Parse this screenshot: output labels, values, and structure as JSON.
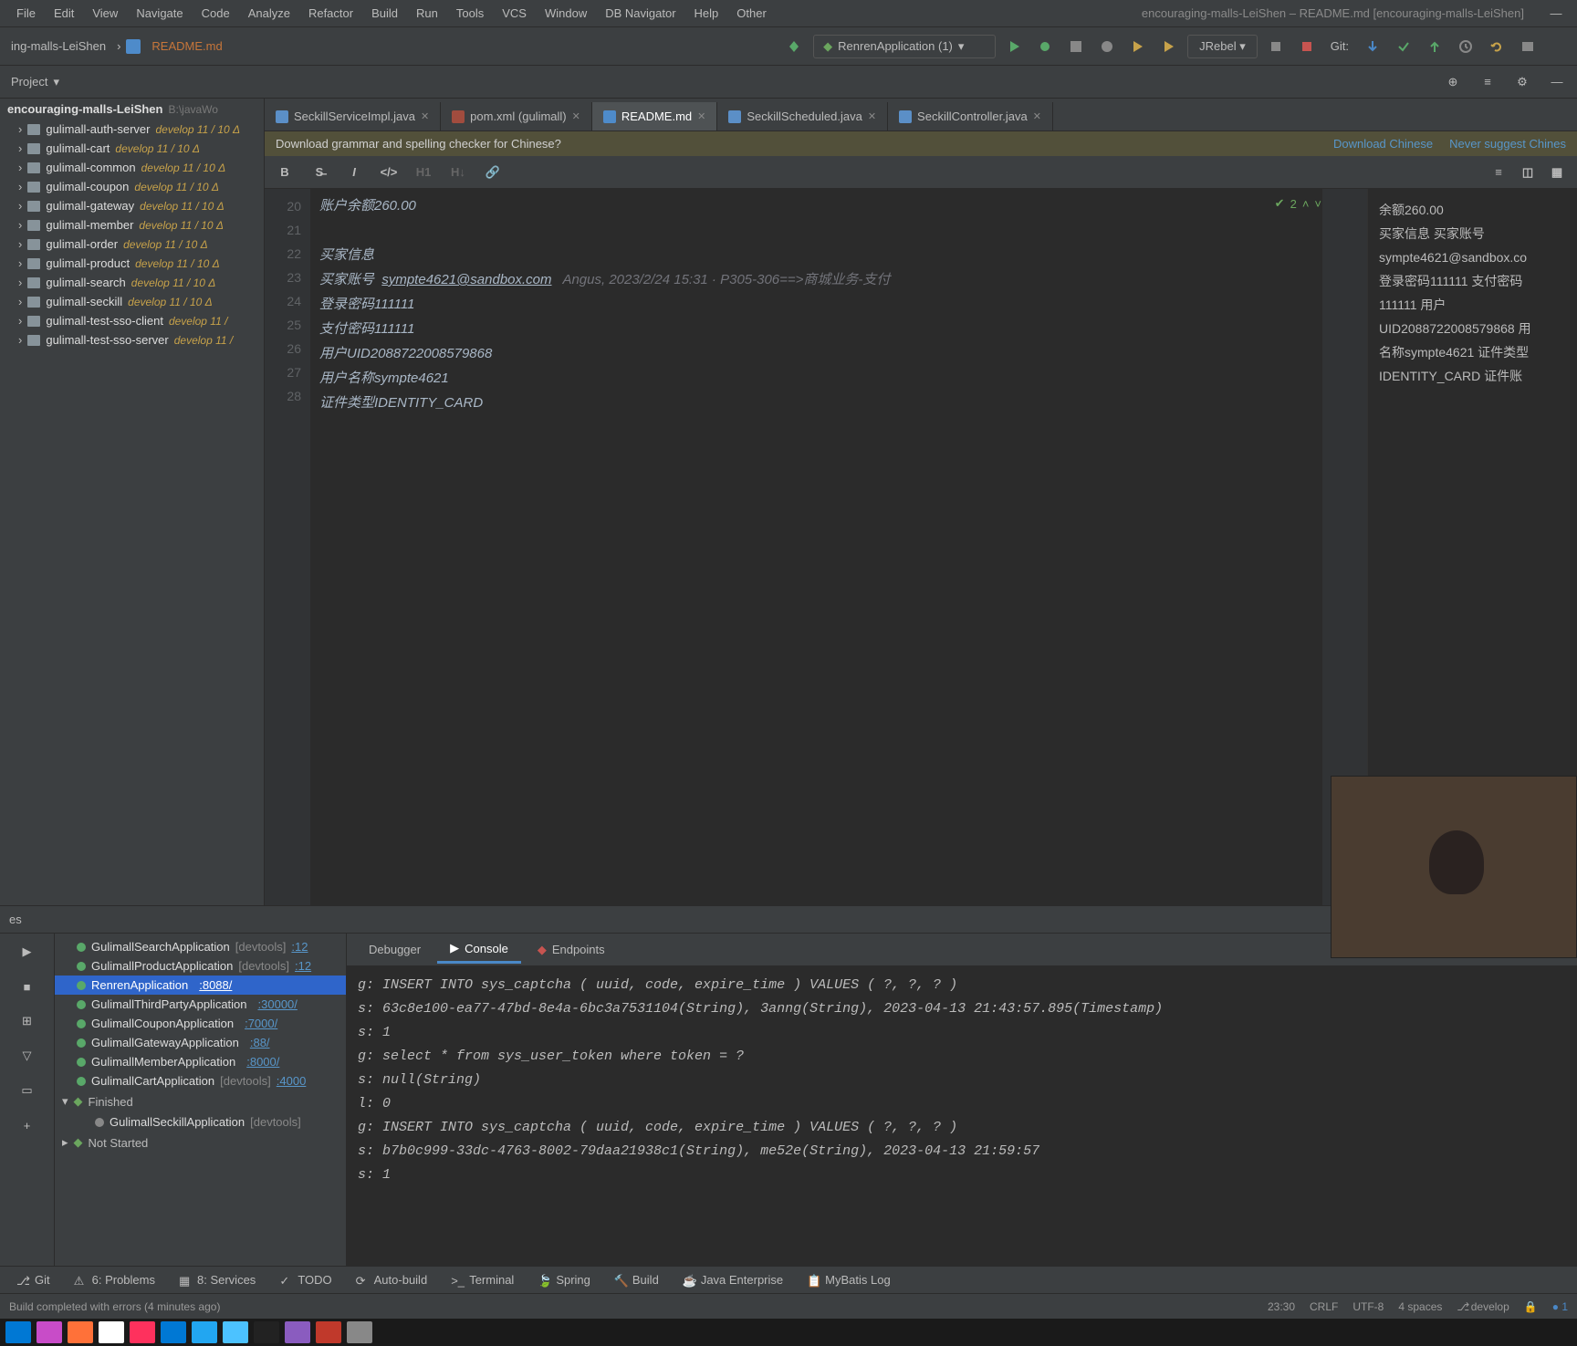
{
  "window_title": "encouraging-malls-LeiShen – README.md [encouraging-malls-LeiShen]",
  "menus": [
    "File",
    "Edit",
    "View",
    "Navigate",
    "Code",
    "Analyze",
    "Refactor",
    "Build",
    "Run",
    "Tools",
    "VCS",
    "Window",
    "DB Navigator",
    "Help",
    "Other"
  ],
  "breadcrumb": {
    "project": "ing-malls-LeiShen",
    "file": "README.md"
  },
  "run_config": "RenrenApplication (1)",
  "jrebel": "JRebel",
  "git_label": "Git:",
  "project_label": "Project",
  "tree_root": {
    "name": "encouraging-malls-LeiShen",
    "path": "B:\\javaWo"
  },
  "tree": [
    {
      "name": "gulimall-auth-server",
      "branch": "develop 11 / 10 Δ"
    },
    {
      "name": "gulimall-cart",
      "branch": "develop 11 / 10 Δ"
    },
    {
      "name": "gulimall-common",
      "branch": "develop 11 / 10 Δ"
    },
    {
      "name": "gulimall-coupon",
      "branch": "develop 11 / 10 Δ"
    },
    {
      "name": "gulimall-gateway",
      "branch": "develop 11 / 10 Δ"
    },
    {
      "name": "gulimall-member",
      "branch": "develop 11 / 10 Δ"
    },
    {
      "name": "gulimall-order",
      "branch": "develop 11 / 10 Δ"
    },
    {
      "name": "gulimall-product",
      "branch": "develop 11 / 10 Δ"
    },
    {
      "name": "gulimall-search",
      "branch": "develop 11 / 10 Δ"
    },
    {
      "name": "gulimall-seckill",
      "branch": "develop 11 / 10 Δ"
    },
    {
      "name": "gulimall-test-sso-client",
      "branch": "develop 11 /"
    },
    {
      "name": "gulimall-test-sso-server",
      "branch": "develop 11 /"
    }
  ],
  "tabs": [
    {
      "label": "SeckillServiceImpl.java",
      "type": "java"
    },
    {
      "label": "pom.xml (gulimall)",
      "type": "xml"
    },
    {
      "label": "README.md",
      "type": "md",
      "active": true
    },
    {
      "label": "SeckillScheduled.java",
      "type": "java"
    },
    {
      "label": "SeckillController.java",
      "type": "java"
    }
  ],
  "banner": {
    "msg": "Download grammar and spelling checker for Chinese?",
    "link1": "Download Chinese",
    "link2": "Never suggest Chines"
  },
  "inspection": {
    "count": "2"
  },
  "gutter": [
    "20",
    "21",
    "22",
    "23",
    "24",
    "25",
    "26",
    "27",
    "28"
  ],
  "code": {
    "l20": "账户余额260.00",
    "l21": "",
    "l22": "买家信息",
    "l23a": "买家账号  ",
    "l23b": "sympte4621@sandbox.com",
    "l23c": "   Angus, 2023/2/24 15:31 · P305-306==>商城业务-支付",
    "l24": "登录密码111111",
    "l25": "支付密码111111",
    "l26": "用户UID2088722008579868",
    "l27": "用户名称sympte4621",
    "l28": "证件类型IDENTITY_CARD"
  },
  "preview": [
    "余额260.00",
    "",
    "买家信息 买家账号",
    "sympte4621@sandbox.co",
    "登录密码111111 支付密码",
    "111111 用户",
    "UID2088722008579868 用",
    "名称sympte4621 证件类型",
    "IDENTITY_CARD 证件账"
  ],
  "svc_header": "",
  "svc_apps": [
    {
      "name": "GulimallSearchApplication",
      "meta": "[devtools]",
      "port": ":12"
    },
    {
      "name": "GulimallProductApplication",
      "meta": "[devtools]",
      "port": ":12"
    },
    {
      "name": "RenrenApplication",
      "meta": "",
      "port": ":8088/",
      "selected": true
    },
    {
      "name": "GulimallThirdPartyApplication",
      "meta": "",
      "port": ":30000/"
    },
    {
      "name": "GulimallCouponApplication",
      "meta": "",
      "port": ":7000/"
    },
    {
      "name": "GulimallGatewayApplication",
      "meta": "",
      "port": ":88/"
    },
    {
      "name": "GulimallMemberApplication",
      "meta": "",
      "port": ":8000/"
    },
    {
      "name": "GulimallCartApplication",
      "meta": "[devtools]",
      "port": ":4000"
    }
  ],
  "svc_groups": [
    {
      "label": "Finished",
      "open": true,
      "children": [
        {
          "name": "GulimallSeckillApplication",
          "meta": "[devtools]"
        }
      ]
    },
    {
      "label": "Not Started",
      "open": false
    }
  ],
  "svc_tabs": {
    "debugger": "Debugger",
    "console": "Console",
    "endpoints": "Endpoints"
  },
  "console_lines": [
    "g: INSERT INTO sys_captcha ( uuid, code, expire_time ) VALUES ( ?, ?, ? )",
    "s: 63c8e100-ea77-47bd-8e4a-6bc3a7531104(String), 3anng(String), 2023-04-13 21:43:57.895(Timestamp)",
    "s: 1",
    "g: select * from sys_user_token where token = ?",
    "s: null(String)",
    "l: 0",
    "g: INSERT INTO sys_captcha ( uuid, code, expire_time ) VALUES ( ?, ?, ? )",
    "s: b7b0c999-33dc-4763-8002-79daa21938c1(String), me52e(String), 2023-04-13 21:59:57",
    "s: 1"
  ],
  "tooltabs": [
    "Git",
    "6: Problems",
    "8: Services",
    "TODO",
    "Auto-build",
    "Terminal",
    "Spring",
    "Build",
    "Java Enterprise",
    "MyBatis Log"
  ],
  "status": {
    "msg": "Build completed with errors (4 minutes ago)",
    "pos": "23:30",
    "eol": "CRLF",
    "enc": "UTF-8",
    "indent": "4 spaces",
    "branch": "develop",
    "procs": "1"
  }
}
